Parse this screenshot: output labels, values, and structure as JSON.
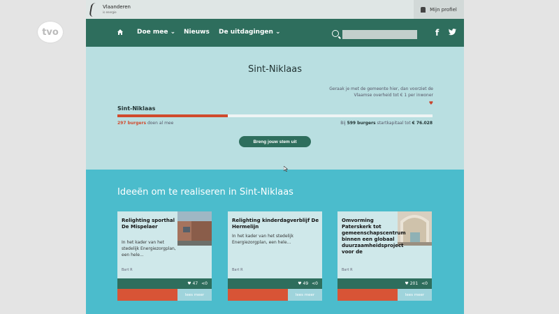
{
  "watermark": {
    "text": "tvo"
  },
  "topbar": {
    "logo_text": "Vlaanderen",
    "logo_sub": "is energie",
    "profile_label": "Mijn profiel"
  },
  "nav": {
    "items": [
      {
        "label": "Doe mee"
      },
      {
        "label": "Nieuws"
      },
      {
        "label": "De uitdagingen"
      }
    ],
    "search_placeholder": ""
  },
  "hero": {
    "title": "Sint-Niklaas",
    "note": "Geraak je met de gemeente hier, dan voorziet de Vlaamse overheid tot € 1 per inwoner",
    "city_label": "Sint-Niklaas",
    "progress_fraction": 0.35,
    "burgers_count": "297 burgers",
    "burgers_suffix": " doen al mee",
    "start_prefix": "Bij ",
    "start_burgers": "599 burgers",
    "start_mid": " startkapitaal tot ",
    "start_amount": "€ 76.028",
    "cta_label": "Breng jouw stem uit"
  },
  "ideas": {
    "title": "Ideeën om te realiseren in Sint-Niklaas",
    "cards": [
      {
        "title": "Relighting sporthal De Mispelaer",
        "text": "In het kader van het stedelijk Energiezorgplan, een hele...",
        "author": "Bart R",
        "likes": "47",
        "shares": "0",
        "more": "lees meer"
      },
      {
        "title": "Relighting kinderdagverblijf De Hermelijn",
        "text": "In het kader van het stedelijk Energiezorgplan, een hele...",
        "author": "Bart R",
        "likes": "49",
        "shares": "0",
        "more": "lees meer"
      },
      {
        "title": "Omvorming Paterskerk tot gemeenschapscentrum binnen een globaal duurzaamheidsproject voor de",
        "text": "",
        "author": "Bart R",
        "likes": "201",
        "shares": "0",
        "more": "lees meer"
      }
    ]
  }
}
